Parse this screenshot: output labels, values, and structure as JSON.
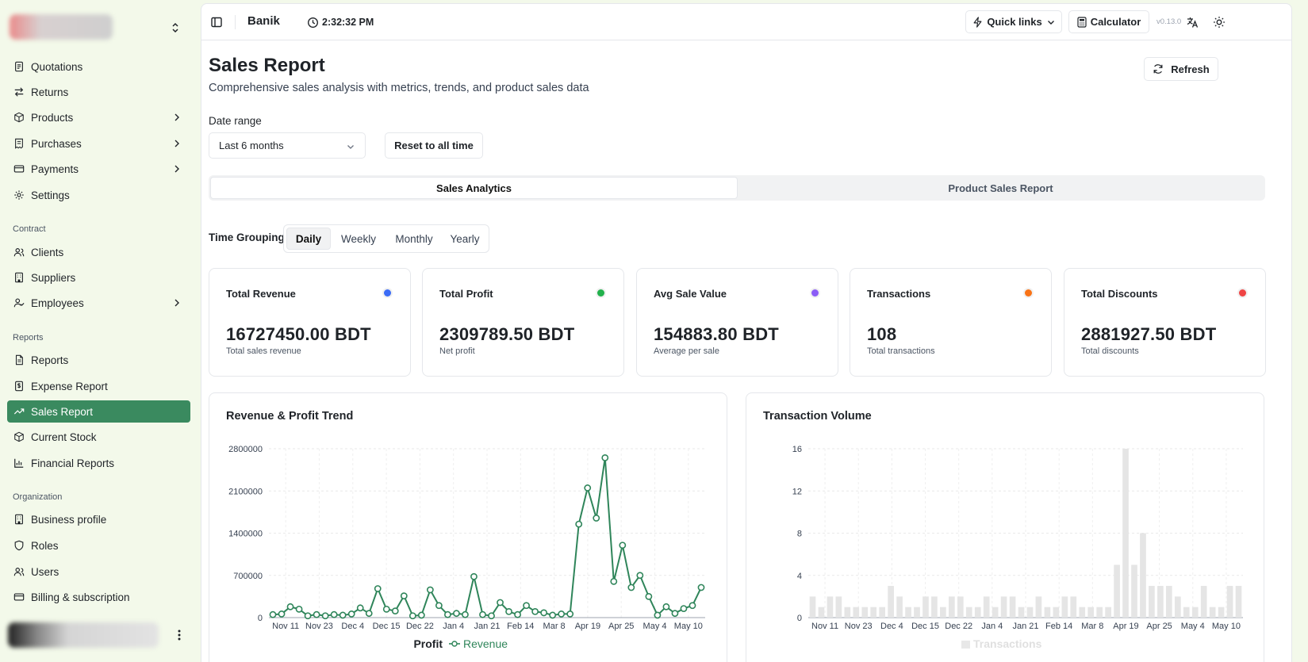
{
  "sidebar": {
    "items_top": [
      {
        "label": "Quotations",
        "icon": "document-icon"
      },
      {
        "label": "Returns",
        "icon": "arrows-icon"
      },
      {
        "label": "Products",
        "icon": "package-icon",
        "expandable": true
      },
      {
        "label": "Purchases",
        "icon": "receipt-icon",
        "expandable": true
      },
      {
        "label": "Payments",
        "icon": "card-icon",
        "expandable": true
      },
      {
        "label": "Settings",
        "icon": "gear-icon"
      }
    ],
    "contract_label": "Contract",
    "items_contract": [
      {
        "label": "Clients",
        "icon": "users-icon"
      },
      {
        "label": "Suppliers",
        "icon": "building-icon"
      },
      {
        "label": "Employees",
        "icon": "user-check-icon",
        "expandable": true
      }
    ],
    "reports_label": "Reports",
    "items_reports": [
      {
        "label": "Reports",
        "icon": "file-icon"
      },
      {
        "label": "Expense Report",
        "icon": "dollar-file-icon"
      },
      {
        "label": "Sales Report",
        "icon": "trend-icon",
        "active": true
      },
      {
        "label": "Current Stock",
        "icon": "package-icon"
      },
      {
        "label": "Financial Reports",
        "icon": "bar-chart-icon"
      }
    ],
    "org_label": "Organization",
    "items_org": [
      {
        "label": "Business profile",
        "icon": "building-icon"
      },
      {
        "label": "Roles",
        "icon": "shield-icon"
      },
      {
        "label": "Users",
        "icon": "users-icon"
      },
      {
        "label": "Billing & subscription",
        "icon": "card-icon"
      }
    ]
  },
  "topbar": {
    "app_name": "Banik",
    "time": "2:32:32 PM",
    "quick_links": "Quick links",
    "calculator": "Calculator",
    "version": "v0.13.0"
  },
  "page": {
    "title": "Sales Report",
    "subtitle": "Comprehensive sales analysis with metrics, trends, and product sales data",
    "refresh": "Refresh",
    "date_range_label": "Date range",
    "date_range_value": "Last 6 months",
    "reset_button": "Reset to all time"
  },
  "tabs": [
    {
      "label": "Sales Analytics",
      "active": true
    },
    {
      "label": "Product Sales Report",
      "active": false
    }
  ],
  "time_grouping": {
    "label": "Time Grouping",
    "options": [
      "Daily",
      "Weekly",
      "Monthly",
      "Yearly"
    ],
    "selected": "Daily"
  },
  "stats": [
    {
      "title": "Total Revenue",
      "value": "16727450.00 BDT",
      "sub": "Total sales revenue",
      "color": "#3b6cf6"
    },
    {
      "title": "Total Profit",
      "value": "2309789.50 BDT",
      "sub": "Net profit",
      "color": "#22b14c"
    },
    {
      "title": "Avg Sale Value",
      "value": "154883.80 BDT",
      "sub": "Average per sale",
      "color": "#8b5cf6"
    },
    {
      "title": "Transactions",
      "value": "108",
      "sub": "Total transactions",
      "color": "#f97316"
    },
    {
      "title": "Total Discounts",
      "value": "2881927.50 BDT",
      "sub": "Total discounts",
      "color": "#ef4444"
    }
  ],
  "chart_data": [
    {
      "type": "line",
      "title": "Revenue & Profit Trend",
      "x_ticks": [
        "Nov 11",
        "Nov 23",
        "Dec 4",
        "Dec 15",
        "Dec 22",
        "Jan 4",
        "Jan 21",
        "Feb 14",
        "Mar 8",
        "Apr 19",
        "Apr 25",
        "May 4",
        "May 10"
      ],
      "y_ticks": [
        "0",
        "700000",
        "1400000",
        "2100000",
        "2800000"
      ],
      "ylim": [
        0,
        2800000
      ],
      "legend": [
        "Profit",
        "Revenue"
      ],
      "series": [
        {
          "name": "Revenue",
          "color": "#2f855a",
          "values": [
            50000,
            60000,
            180000,
            140000,
            30000,
            50000,
            30000,
            50000,
            40000,
            60000,
            160000,
            70000,
            480000,
            140000,
            110000,
            360000,
            30000,
            40000,
            460000,
            200000,
            50000,
            70000,
            50000,
            680000,
            50000,
            30000,
            250000,
            100000,
            50000,
            200000,
            100000,
            80000,
            40000,
            60000,
            60000,
            1550000,
            2150000,
            1650000,
            2650000,
            600000,
            1200000,
            500000,
            700000,
            350000,
            40000,
            180000,
            70000,
            150000,
            200000,
            500000
          ]
        }
      ]
    },
    {
      "type": "bar",
      "title": "Transaction Volume",
      "x_ticks": [
        "Nov 11",
        "Nov 23",
        "Dec 4",
        "Dec 15",
        "Dec 22",
        "Jan 4",
        "Jan 21",
        "Feb 14",
        "Mar 8",
        "Apr 19",
        "Apr 25",
        "May 4",
        "May 10"
      ],
      "y_ticks": [
        "0",
        "4",
        "8",
        "12",
        "16"
      ],
      "ylim": [
        0,
        16
      ],
      "legend": [
        "Transactions"
      ],
      "series": [
        {
          "name": "Transactions",
          "color": "#e5e5e5",
          "values": [
            2,
            1,
            2,
            2,
            1,
            1,
            1,
            1,
            1,
            3,
            2,
            1,
            1,
            2,
            2,
            1,
            2,
            2,
            1,
            1,
            2,
            1,
            2,
            2,
            1,
            1,
            2,
            1,
            1,
            2,
            2,
            1,
            1,
            1,
            1,
            5,
            16,
            5,
            8,
            3,
            3,
            3,
            2,
            1,
            1,
            3,
            1,
            1,
            3,
            3
          ]
        }
      ]
    }
  ]
}
